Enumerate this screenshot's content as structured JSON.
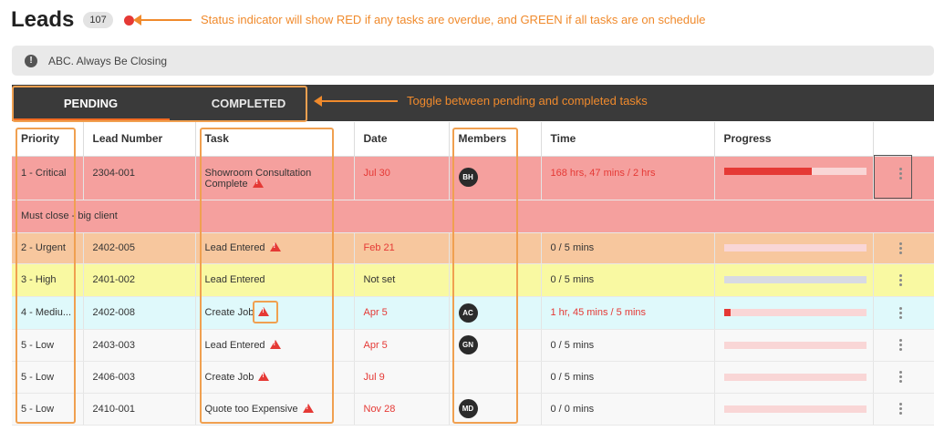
{
  "header": {
    "title": "Leads",
    "count": "107",
    "status_color": "#e53935"
  },
  "annotations": {
    "status": "Status indicator will show RED if any tasks are overdue, and GREEN if all tasks are on schedule",
    "toggle": "Toggle between pending and completed tasks"
  },
  "banner": {
    "icon": "!",
    "text": "ABC. Always Be Closing"
  },
  "tabs": [
    {
      "label": "PENDING",
      "active": true
    },
    {
      "label": "COMPLETED",
      "active": false
    }
  ],
  "table": {
    "columns": [
      "Priority",
      "Lead Number",
      "Task",
      "Date",
      "Members",
      "Time",
      "Progress"
    ],
    "rows": [
      {
        "priority": "1 - Critical",
        "lead": "2304-001",
        "task": "Showroom Consultation Complete",
        "warning": true,
        "date": "Jul 30",
        "date_overdue": true,
        "member": "BH",
        "time": "168 hrs, 47 mins / 2 hrs",
        "time_overdue": true,
        "progress": 0.62,
        "note": "Must close - big client"
      },
      {
        "priority": "2 - Urgent",
        "lead": "2402-005",
        "task": "Lead Entered",
        "warning": true,
        "date": "Feb 21",
        "date_overdue": true,
        "member": "",
        "time": "0 / 5 mins",
        "time_overdue": false,
        "progress": 0
      },
      {
        "priority": "3 - High",
        "lead": "2401-002",
        "task": "Lead Entered",
        "warning": false,
        "date": "Not set",
        "date_overdue": false,
        "member": "",
        "time": "0 / 5 mins",
        "time_overdue": false,
        "progress": 0
      },
      {
        "priority": "4 - Mediu...",
        "lead": "2402-008",
        "task": "Create Job",
        "warning": true,
        "date": "Apr 5",
        "date_overdue": true,
        "member": "AC",
        "time": "1 hr, 45 mins / 5 mins",
        "time_overdue": true,
        "progress": 0.05
      },
      {
        "priority": "5 - Low",
        "lead": "2403-003",
        "task": "Lead Entered",
        "warning": true,
        "date": "Apr 5",
        "date_overdue": true,
        "member": "GN",
        "time": "0 / 5 mins",
        "time_overdue": false,
        "progress": 0
      },
      {
        "priority": "5 - Low",
        "lead": "2406-003",
        "task": "Create Job",
        "warning": true,
        "date": "Jul 9",
        "date_overdue": true,
        "member": "",
        "time": "0 / 5 mins",
        "time_overdue": false,
        "progress": 0
      },
      {
        "priority": "5 - Low",
        "lead": "2410-001",
        "task": "Quote too Expensive",
        "warning": true,
        "date": "Nov 28",
        "date_overdue": true,
        "member": "MD",
        "time": "0 / 0 mins",
        "time_overdue": false,
        "progress": 0
      }
    ]
  }
}
